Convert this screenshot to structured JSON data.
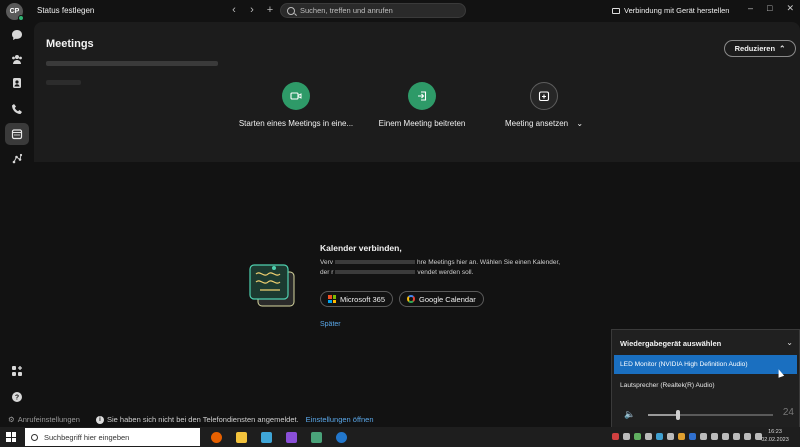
{
  "titlebar": {
    "avatar_initials": "CP",
    "status_label": "Status festlegen",
    "back_icon": "‹",
    "forward_icon": "›",
    "add_icon": "+",
    "search_placeholder": "Suchen, treffen und anrufen",
    "connect_device_label": "Verbindung mit Gerät herstellen",
    "minimize": "–",
    "maximize": "□",
    "close": "✕"
  },
  "sidebar": {
    "items": [
      {
        "icon": "chat-icon"
      },
      {
        "icon": "teams-icon"
      },
      {
        "icon": "contacts-icon"
      },
      {
        "icon": "phone-icon"
      },
      {
        "icon": "calendar-icon",
        "active": true
      },
      {
        "icon": "activity-icon"
      }
    ],
    "bottom_items": [
      {
        "icon": "apps-icon"
      },
      {
        "icon": "help-icon"
      }
    ]
  },
  "meetings": {
    "title": "Meetings",
    "reduce_label": "Reduzieren",
    "actions": [
      {
        "label": "Starten eines Meetings in eine...",
        "icon": "video-icon"
      },
      {
        "label": "Einem Meeting beitreten",
        "icon": "join-icon"
      },
      {
        "label": "Meeting ansetzen",
        "icon": "schedule-icon"
      }
    ]
  },
  "calendar": {
    "title": "Kalender verbinden,",
    "desc_line1_start": "Verv",
    "desc_line1_end": "hre Meetings hier an. Wählen Sie einen Kalender,",
    "desc_line2_start": "der r",
    "desc_line2_end": "vendet werden soll.",
    "microsoft_label": "Microsoft 365",
    "google_label": "Google Calendar",
    "later_label": "Später"
  },
  "footer": {
    "call_settings_label": "Anrufeinstellungen",
    "notice_text": "Sie haben sich nicht bei den Telefondiensten angemeldet.",
    "notice_link": "Einstellungen öffnen"
  },
  "audio_flyout": {
    "title": "Wiedergabegerät auswählen",
    "devices": [
      {
        "label": "LED Monitor (NVIDIA High Definition Audio)",
        "selected": true
      },
      {
        "label": "Lautsprecher (Realtek(R) Audio)",
        "selected": false
      }
    ],
    "volume": 24,
    "volume_fraction": 0.24
  },
  "taskbar": {
    "search_placeholder": "Suchbegriff hier eingeben",
    "time": "16:23",
    "date": "02.02.2023"
  },
  "colors": {
    "accent_green": "#2e9a68",
    "selected_blue": "#1a6fc0",
    "link_blue": "#5aa7e8"
  }
}
